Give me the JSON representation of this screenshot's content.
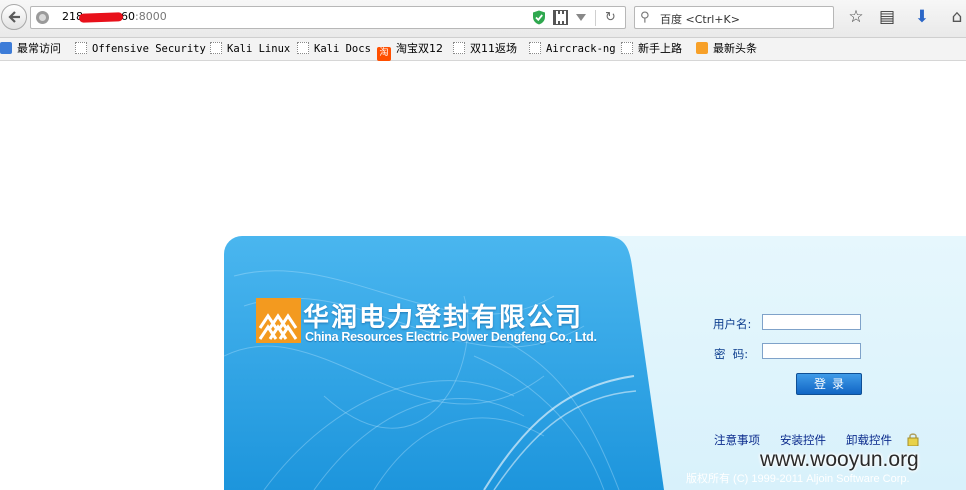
{
  "browser": {
    "url_prefix": "218",
    "url_suffix": "60",
    "url_port": ":8000",
    "search_placeholder": "百度 <Ctrl+K>",
    "icons": [
      "back-icon",
      "globe-icon",
      "shield-icon",
      "qr-code-icon",
      "dropdown-icon",
      "reload-icon",
      "search-icon",
      "star-icon",
      "bookmarks-icon",
      "download-icon",
      "home-icon"
    ]
  },
  "bookmarks": [
    {
      "label": "最常访问",
      "icon": "most-visited-icon"
    },
    {
      "label": "Offensive Security",
      "icon": "page-icon"
    },
    {
      "label": "Kali Linux",
      "icon": "page-icon"
    },
    {
      "label": "Kali Docs",
      "icon": "page-icon"
    },
    {
      "label": "淘宝双12",
      "icon": "taobao-icon",
      "icon_text": "淘"
    },
    {
      "label": "双11返场",
      "icon": "page-icon"
    },
    {
      "label": "Aircrack-ng",
      "icon": "page-icon"
    },
    {
      "label": "新手上路",
      "icon": "page-icon"
    },
    {
      "label": "最新头条",
      "icon": "rss-icon"
    }
  ],
  "login": {
    "company_name_cn": "华润电力登封有限公司",
    "company_name_en": "China Resources Electric Power Dengfeng Co., Ltd.",
    "username_label": "用户名:",
    "password_label": "密  码:",
    "login_button": "登录",
    "links": [
      "注意事项",
      "安装控件",
      "卸载控件"
    ],
    "copyright": "版权所有 (C) 1999-2011 Aljoin Software Corp."
  },
  "watermark": "www.wooyun.org",
  "colors": {
    "panel_blue": "#33a8e8",
    "panel_light": "#dff4fc",
    "logo_orange": "#f39a1f",
    "button_blue": "#1a70cc",
    "redaction": "#e8101a"
  }
}
